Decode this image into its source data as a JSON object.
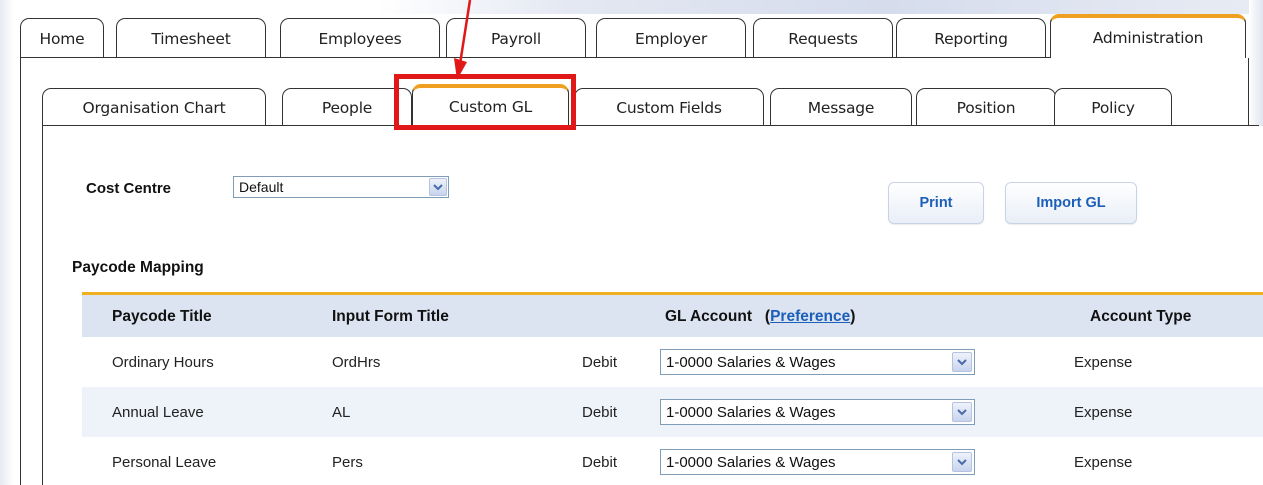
{
  "main_tabs": [
    {
      "label": "Home"
    },
    {
      "label": "Timesheet"
    },
    {
      "label": "Employees"
    },
    {
      "label": "Payroll"
    },
    {
      "label": "Employer"
    },
    {
      "label": "Requests"
    },
    {
      "label": "Reporting"
    },
    {
      "label": "Administration",
      "active": true
    }
  ],
  "sub_tabs": [
    {
      "label": "Organisation Chart"
    },
    {
      "label": "People"
    },
    {
      "label": "Custom GL",
      "active": true
    },
    {
      "label": "Custom Fields"
    },
    {
      "label": "Message"
    },
    {
      "label": "Position"
    },
    {
      "label": "Policy"
    }
  ],
  "cost_centre": {
    "label": "Cost Centre",
    "value": "Default"
  },
  "buttons": {
    "print": "Print",
    "import": "Import GL"
  },
  "section": {
    "title": "Paycode Mapping"
  },
  "table": {
    "headers": {
      "paycode_title": "Paycode Title",
      "input_form_title": "Input Form Title",
      "gl_account": "GL Account",
      "preference_open": "(",
      "preference_link": "Preference",
      "preference_close": ")",
      "account_type": "Account Type"
    },
    "rows": [
      {
        "paycode": "Ordinary Hours",
        "input": "OrdHrs",
        "dc": "Debit",
        "gl": "1-0000 Salaries & Wages",
        "type": "Expense"
      },
      {
        "paycode": "Annual Leave",
        "input": "AL",
        "dc": "Debit",
        "gl": "1-0000 Salaries & Wages",
        "type": "Expense"
      },
      {
        "paycode": "Personal Leave",
        "input": "Pers",
        "dc": "Debit",
        "gl": "1-0000 Salaries & Wages",
        "type": "Expense"
      }
    ]
  },
  "colors": {
    "active_tab_accent": "#f0a020",
    "highlight_box": "#e01818",
    "link_blue": "#1c5fb8",
    "header_bg": "#dce4f2",
    "alt_row_bg": "#eef2f9"
  }
}
